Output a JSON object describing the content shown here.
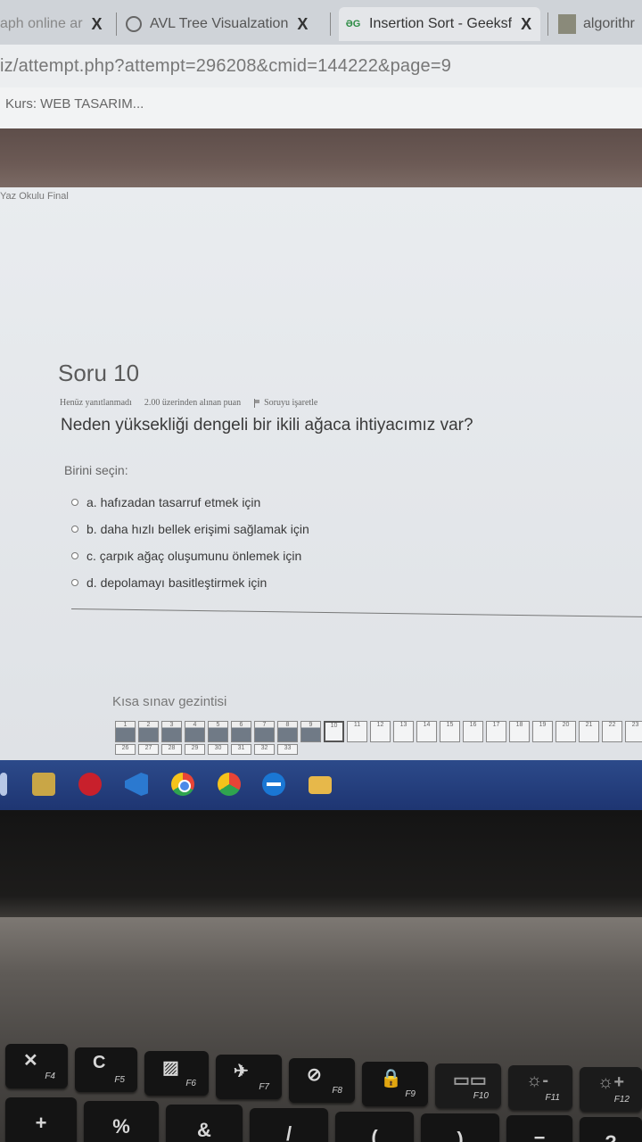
{
  "browser": {
    "tabs": [
      {
        "title": "aph online ar",
        "close": "X"
      },
      {
        "title": "AVL Tree Visualzation",
        "close": "X"
      },
      {
        "title": "Insertion Sort - Geeksf",
        "close": "X"
      },
      {
        "title": "algorithr"
      }
    ],
    "url": "iz/attempt.php?attempt=296208&cmid=144222&page=9",
    "bookmark": "Kurs: WEB TASARIM..."
  },
  "page": {
    "breadcrumb": "Yaz Okulu Final",
    "question": {
      "number_label": "Soru 10",
      "status": "Henüz yanıtlanmadı",
      "points": "2.00 üzerinden alınan puan",
      "flag_label": "Soruyu işaretle",
      "text": "Neden yüksekliği dengeli bir ikili ağaca ihtiyacımız var?",
      "prompt": "Birini seçin:",
      "options": [
        "a. hafızadan tasarruf etmek için",
        "b. daha hızlı bellek erişimi sağlamak için",
        "c. çarpık ağaç oluşumunu önlemek için",
        "d. depolamayı basitleştirmek için"
      ]
    },
    "quiz_nav": {
      "title": "Kısa sınav gezintisi",
      "row1": [
        "1",
        "2",
        "3",
        "4",
        "5",
        "6",
        "7",
        "8",
        "9",
        "10",
        "11",
        "12",
        "13",
        "14",
        "15",
        "16",
        "17",
        "18",
        "19",
        "20",
        "21",
        "22",
        "23"
      ],
      "row2": [
        "26",
        "27",
        "28",
        "29",
        "30",
        "31",
        "32",
        "33"
      ],
      "answered_count": 9,
      "current": "10"
    }
  },
  "taskbar": {
    "icons": [
      "windows-start-icon",
      "file-explorer-icon",
      "opera-icon",
      "vscode-icon",
      "chrome-icon",
      "chrome-profile-icon",
      "teamviewer-icon",
      "folder-icon"
    ]
  },
  "keyboard": {
    "function_keys": [
      {
        "symbol": "✕",
        "label": "F4"
      },
      {
        "symbol": "C",
        "label": "F5"
      },
      {
        "symbol": "▨",
        "label": "F6"
      },
      {
        "symbol": "✈",
        "label": "F7"
      },
      {
        "symbol": "⊘",
        "label": "F8"
      },
      {
        "symbol": "🔒",
        "label": "F9"
      },
      {
        "symbol": "▭▭",
        "label": "F10"
      },
      {
        "symbol": "☼-",
        "label": "F11"
      },
      {
        "symbol": "☼+",
        "label": "F12"
      }
    ],
    "number_row": [
      "+",
      "%",
      "&",
      "/",
      "(",
      ")",
      "=",
      "?"
    ]
  }
}
